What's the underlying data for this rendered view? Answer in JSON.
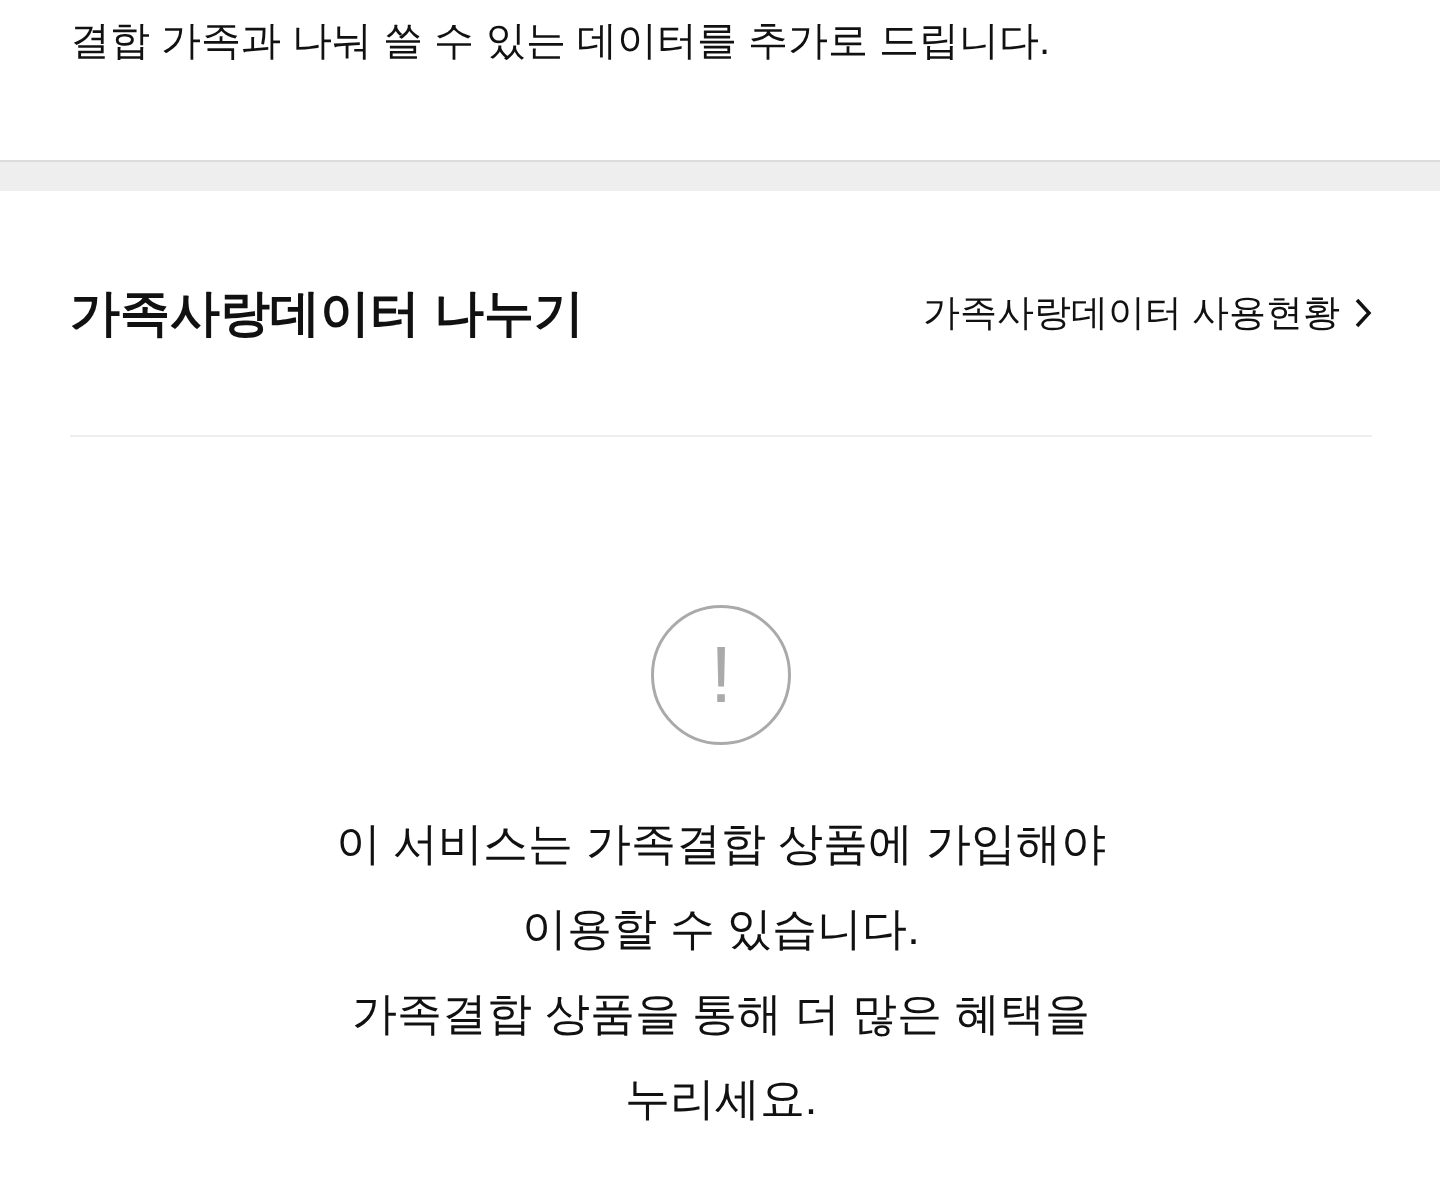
{
  "intro": {
    "text": "결합 가족과 나눠 쓸 수 있는 데이터를 추가로 드립니다."
  },
  "section": {
    "title": "가족사랑데이터 나누기",
    "link": "가족사랑데이터 사용현황"
  },
  "notice": {
    "icon": "!",
    "lines": [
      "이 서비스는 가족결합 상품에 가입해야",
      "이용할 수 있습니다.",
      "가족결합 상품을 통해 더 많은 혜택을",
      "누리세요."
    ]
  }
}
